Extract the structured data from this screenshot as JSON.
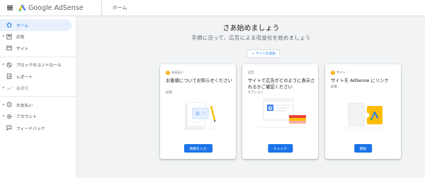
{
  "header": {
    "app_name": "Google AdSense",
    "page_title": "ホーム",
    "colors": {
      "brand_blue": "#1a73e8",
      "brand_yellow": "#fbbc04",
      "brand_green": "#34a853"
    }
  },
  "sidebar": {
    "items": [
      {
        "label": "ホーム",
        "icon": "home-icon",
        "active": true
      },
      {
        "label": "広告",
        "icon": "ads-icon",
        "expandable": true
      },
      {
        "label": "サイト",
        "icon": "sites-icon"
      },
      {
        "label": "ブロックのコントロール",
        "icon": "block-icon",
        "expandable": true
      },
      {
        "label": "レポート",
        "icon": "report-icon"
      },
      {
        "label": "最適化",
        "icon": "optimize-icon",
        "expandable": true,
        "disabled": true
      },
      {
        "label": "お支払い",
        "icon": "payments-icon",
        "expandable": true
      },
      {
        "label": "アカウント",
        "icon": "account-icon",
        "expandable": true
      },
      {
        "label": "フィードバック",
        "icon": "feedback-icon"
      }
    ]
  },
  "main": {
    "title": "さあ始めましょう",
    "subtitle": "手順に沿って、広告による収益化を始めましょう",
    "add_site_label": "サイトを追加",
    "cards": [
      {
        "category": "お支払い",
        "has_warning": true,
        "title": "お客様についてお知らせください",
        "status": "必須",
        "button": "情報を入力",
        "illustration": "payment-info-illustration"
      },
      {
        "category": "広告",
        "has_warning": false,
        "title": "サイトで広告がどのように表示されるかご確認ください",
        "status": "オプション",
        "button": "チェック",
        "illustration": "ads-preview-illustration"
      },
      {
        "category": "サイト",
        "has_warning": true,
        "title": "サイトを AdSense にリンク",
        "status": "必須",
        "button": "開始",
        "illustration": "site-link-illustration"
      }
    ]
  }
}
